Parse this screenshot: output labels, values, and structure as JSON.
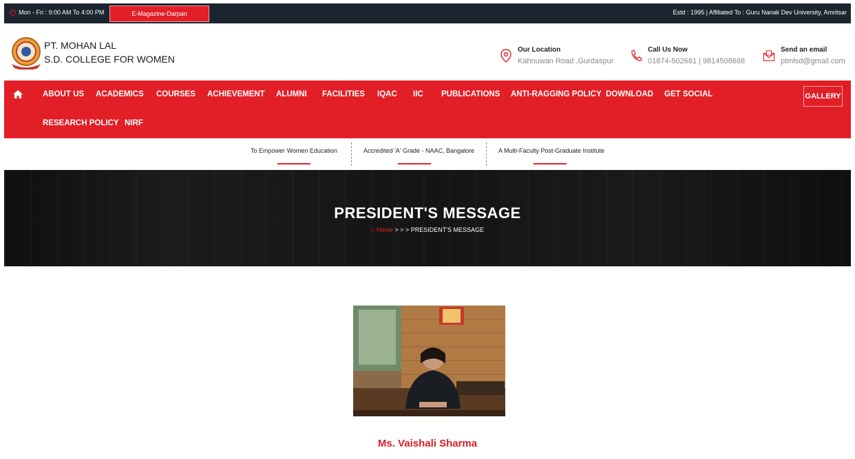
{
  "topbar": {
    "hours": "Mon - Fri : 9:00 AM To 4:00 PM",
    "emagazine": "E-Magazine-Darpan",
    "affiliation": "Estd : 1995 | Affiliated To : Guru Nanak Dev University, Amritsar"
  },
  "header": {
    "name_line1": "PT. MOHAN LAL",
    "name_line2": "S.D. COLLEGE FOR WOMEN",
    "location_label": "Our Location",
    "location_value": "Kahnuwan Road ,Gurdaspur",
    "call_label": "Call Us Now",
    "call_value": "01874-502681 | 9814508688",
    "email_label": "Send an email",
    "email_value": "ptmlsd@gmail.com"
  },
  "nav": {
    "items": [
      "ABOUT US",
      "ACADEMICS",
      "COURSES",
      "ACHIEVEMENT",
      "ALUMNI",
      "FACILITIES",
      "IQAC",
      "IIC",
      "PUBLICATIONS",
      "ANTI-RAGGING POLICY",
      "DOWNLOAD",
      "GET SOCIAL",
      "RESEARCH POLICY",
      "NIRF"
    ],
    "gallery": "GALLERY"
  },
  "taglines": [
    "To Empower Women Education",
    "Accredited 'A' Grade - NAAC, Bangalore",
    "A Multi-Faculty Post-Graduate Institute"
  ],
  "banner": {
    "title": "PRESIDENT'S MESSAGE",
    "crumb_home": "Home",
    "crumb_sep": " > > > ",
    "crumb_current": "PRESIDENT'S MESSAGE"
  },
  "president": {
    "name": "Ms. Vaishali Sharma"
  },
  "colors": {
    "accent": "#e21f26",
    "topbar": "#1b2530"
  }
}
